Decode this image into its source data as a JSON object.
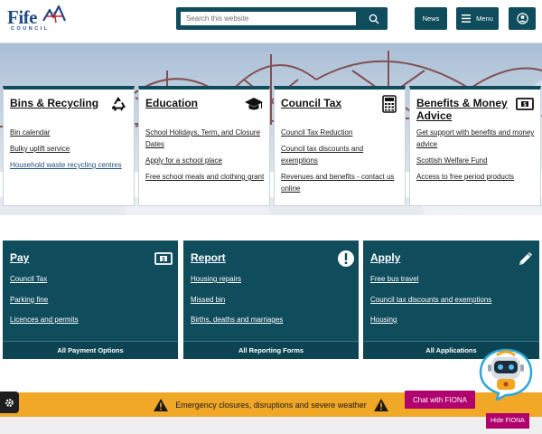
{
  "header": {
    "logo_text": "Fife",
    "logo_sub": "COUNCIL",
    "search": {
      "placeholder": "Search this website"
    },
    "news_label": "News",
    "menu_label": "Menu"
  },
  "top_cards": [
    {
      "title": "Bins & Recycling",
      "icon": "recycle-icon",
      "links": [
        "Bin calendar",
        "Bulky uplift service",
        "Household waste recycling centres"
      ]
    },
    {
      "title": "Education",
      "icon": "graduation-cap-icon",
      "links": [
        "School Holidays, Term, and Closure Dates",
        "Apply for a school place",
        "Free school meals and clothing grant"
      ]
    },
    {
      "title": "Council Tax",
      "icon": "calculator-icon",
      "links": [
        "Council Tax Reduction",
        "Council tax discounts and exemptions",
        "Revenues and benefits - contact us online"
      ]
    },
    {
      "title": "Benefits & Money Advice",
      "icon": "banknote-icon",
      "links": [
        "Get support with benefits and money advice",
        "Scottish Welfare Fund",
        "Access to free period products"
      ]
    }
  ],
  "action_cards": [
    {
      "title": "Pay",
      "icon": "banknote-icon",
      "links": [
        "Council Tax",
        "Parking fine",
        "Licences and permits"
      ],
      "footer": "All Payment Options"
    },
    {
      "title": "Report",
      "icon": "exclamation-icon",
      "links": [
        "Housing repairs",
        "Missed bin",
        "Births, deaths and marriages"
      ],
      "footer": "All Reporting Forms"
    },
    {
      "title": "Apply",
      "icon": "pencil-icon",
      "links": [
        "Free bus travel",
        "Council tax discounts and exemptions",
        "Housing"
      ],
      "footer": "All Applications"
    }
  ],
  "alert": {
    "text": "Emergency closures, disruptions and severe weather"
  },
  "chat": {
    "open_label": "Chat with FIONA",
    "hide_label": "Hide FIONA"
  },
  "colors": {
    "primary": "#0f4c5c",
    "alert": "#f1a826",
    "chat": "#b0006d"
  }
}
